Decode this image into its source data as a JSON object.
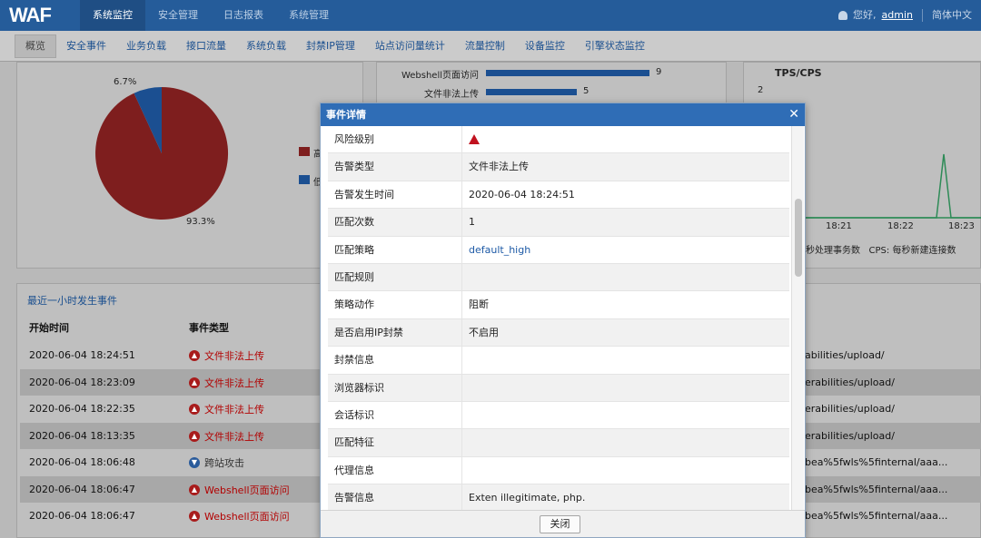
{
  "header": {
    "logo": "WAF",
    "nav": [
      "系统监控",
      "安全管理",
      "日志报表",
      "系统管理"
    ],
    "greeting": "您好,",
    "user": "admin",
    "language": "简体中文"
  },
  "subnav": [
    "概览",
    "安全事件",
    "业务负载",
    "接口流量",
    "系统负载",
    "封禁IP管理",
    "站点访问量统计",
    "流量控制",
    "设备监控",
    "引擎状态监控"
  ],
  "pie": {
    "label_small": "6.7%",
    "label_large": "93.3%",
    "legend": [
      "高",
      "低"
    ]
  },
  "bar_chart": {
    "rows": [
      {
        "label": "Webshell页面访问",
        "value": 9
      },
      {
        "label": "文件非法上传",
        "value": 5
      }
    ]
  },
  "tps": {
    "title": "TPS/CPS",
    "y_tick": "2",
    "times": [
      "18:21",
      "18:22",
      "18:23"
    ],
    "legend": "秒处理事务数   CPS: 每秒新建连接数"
  },
  "events": {
    "title": "最近一小时发生事件",
    "col_time": "开始时间",
    "col_type": "事件类型",
    "rows": [
      {
        "time": "2020-06-04 18:24:51",
        "type": "文件非法上传",
        "url": "abilities/upload/",
        "kind": "up"
      },
      {
        "time": "2020-06-04 18:23:09",
        "type": "文件非法上传",
        "url": "erabilities/upload/",
        "kind": "up"
      },
      {
        "time": "2020-06-04 18:22:35",
        "type": "文件非法上传",
        "url": "erabilities/upload/",
        "kind": "up"
      },
      {
        "time": "2020-06-04 18:13:35",
        "type": "文件非法上传",
        "url": "erabilities/upload/",
        "kind": "up"
      },
      {
        "time": "2020-06-04 18:06:48",
        "type": "跨站攻击",
        "url": "bea%5fwls%5finternal/aaa...",
        "kind": "down"
      },
      {
        "time": "2020-06-04 18:06:47",
        "type": "Webshell页面访问",
        "url": "bea%5fwls%5finternal/aaa...",
        "kind": "up"
      },
      {
        "time": "2020-06-04 18:06:47",
        "type": "Webshell页面访问",
        "url": "bea%5fwls%5finternal/aaa...",
        "kind": "up"
      }
    ]
  },
  "modal": {
    "title": "事件详情",
    "close_label": "关闭",
    "rows": [
      {
        "key": "风险级别",
        "value": ""
      },
      {
        "key": "告警类型",
        "value": "文件非法上传"
      },
      {
        "key": "告警发生时间",
        "value": "2020-06-04 18:24:51"
      },
      {
        "key": "匹配次数",
        "value": "1"
      },
      {
        "key": "匹配策略",
        "value": "default_high"
      },
      {
        "key": "匹配规则",
        "value": ""
      },
      {
        "key": "策略动作",
        "value": "阻断"
      },
      {
        "key": "是否启用IP封禁",
        "value": "不启用"
      },
      {
        "key": "封禁信息",
        "value": ""
      },
      {
        "key": "浏览器标识",
        "value": ""
      },
      {
        "key": "会话标识",
        "value": ""
      },
      {
        "key": "匹配特征",
        "value": ""
      },
      {
        "key": "代理信息",
        "value": ""
      },
      {
        "key": "告警信息",
        "value": "Exten illegitimate, php."
      }
    ]
  }
}
